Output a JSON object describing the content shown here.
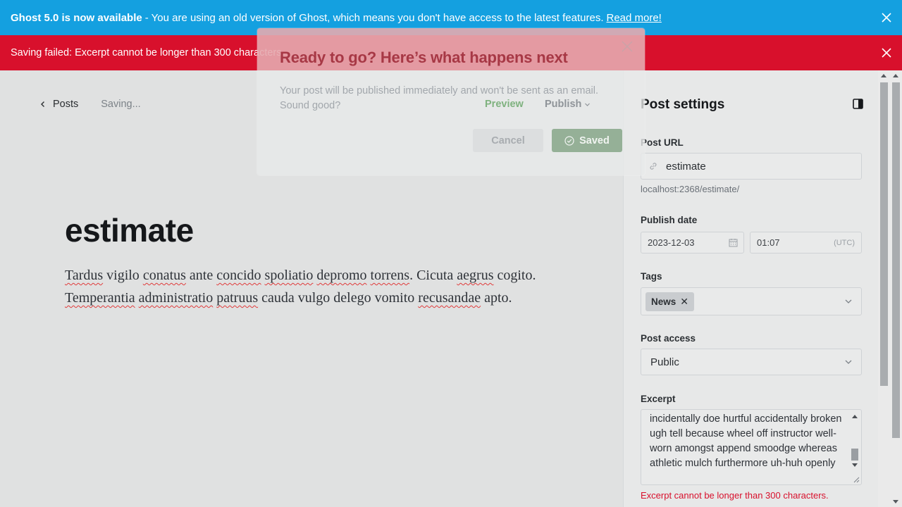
{
  "banners": {
    "upgrade": {
      "title": "Ghost 5.0 is now available",
      "message": "- You are using an old version of Ghost, which means you don't have access to the latest features.",
      "link": "Read more!"
    },
    "error": {
      "message": "Saving failed: Excerpt cannot be longer than 300 characters."
    }
  },
  "editor": {
    "back_label": "Posts",
    "status": "Saving...",
    "title": "estimate",
    "body_words": [
      {
        "t": "Tardus",
        "s": true
      },
      {
        "t": " vigilo ",
        "s": false
      },
      {
        "t": "conatus",
        "s": true
      },
      {
        "t": " ante ",
        "s": false
      },
      {
        "t": "concido",
        "s": true
      },
      {
        "t": " ",
        "s": false
      },
      {
        "t": "spoliatio",
        "s": true
      },
      {
        "t": " ",
        "s": false
      },
      {
        "t": "depromo",
        "s": true
      },
      {
        "t": " ",
        "s": false
      },
      {
        "t": "torrens",
        "s": true
      },
      {
        "t": ". Cicuta ",
        "s": false
      },
      {
        "t": "aegrus",
        "s": true
      },
      {
        "t": " cogito. ",
        "s": false
      },
      {
        "t": "Temperantia",
        "s": true
      },
      {
        "t": " ",
        "s": false
      },
      {
        "t": "administratio",
        "s": true
      },
      {
        "t": " ",
        "s": false
      },
      {
        "t": "patruus",
        "s": true
      },
      {
        "t": " cauda vulgo delego vomito ",
        "s": false
      },
      {
        "t": "recusandae",
        "s": true
      },
      {
        "t": " apto.",
        "s": false
      }
    ]
  },
  "settings": {
    "title": "Post settings",
    "post_url_label": "Post URL",
    "post_url_value": "estimate",
    "post_url_hint": "localhost:2368/estimate/",
    "publish_date_label": "Publish date",
    "publish_date": "2023-12-03",
    "publish_time": "01:07",
    "timezone": "(UTC)",
    "tags_label": "Tags",
    "tags": [
      "News"
    ],
    "access_label": "Post access",
    "access_value": "Public",
    "excerpt_label": "Excerpt",
    "excerpt_text": "incidentally doe hurtful accidentally broken ugh tell because wheel off instructor well-worn amongst append smoodge whereas athletic mulch furthermore uh-huh openly",
    "excerpt_error": "Excerpt cannot be longer than 300 characters."
  },
  "modal": {
    "title": "Ready to go? Here’s what happens next",
    "text": "Your post will be published immediately and won't be sent as an email. Sound good?",
    "preview_label": "Preview",
    "publish_label": "Publish",
    "cancel_label": "Cancel",
    "saved_label": "Saved"
  },
  "colors": {
    "upgrade_banner": "#14a0e0",
    "error_banner": "#d8102c",
    "saved_button": "#95b097"
  }
}
